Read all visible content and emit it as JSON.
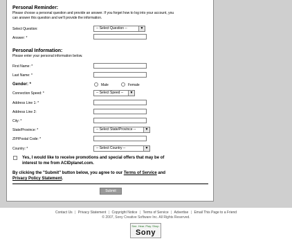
{
  "reminder": {
    "title": "Personal Reminder:",
    "desc_line1": "Please choose a personal question and provide an answer. If you forget how to log into your account, you",
    "desc_line2": "can answer this question and we'll provide the information.",
    "question_label": "Select Question:",
    "question_value": "-- Select Question --",
    "answer_label": "Answer: *",
    "answer_value": ""
  },
  "info": {
    "title": "Personal Information:",
    "desc": "Please enter your personal information below.",
    "first_name_label": "First Name: *",
    "last_name_label": "Last Name: *",
    "gender_label": "Gender: *",
    "male_label": "Male",
    "female_label": "Female",
    "speed_label": "Connection Speed: *",
    "speed_value": "-- Select Speed --",
    "address1_label": "Address Line 1: *",
    "address2_label": "Address Line 2:",
    "city_label": "City: *",
    "state_label": "State/Province: *",
    "state_value": "-- Select State/Province --",
    "zip_label": "ZIP/Postal Code: *",
    "country_label": "Country: *",
    "country_value": "-- Select Country --"
  },
  "promo": {
    "line1": "Yes, I would like to receive promotions and special offers that may be of",
    "line2": "interest to me from ACIDplanet.com."
  },
  "terms": {
    "prefix": "By clicking the \"Submit\" button below, you agree to our ",
    "tos": "Terms of Service",
    "and": " and",
    "privacy": "Privacy Policy Statement",
    "end": "."
  },
  "submit_label": "Submit",
  "footer": {
    "links": [
      "Contact Us",
      "Privacy Statement",
      "Copyright Notice",
      "Terms of Service",
      "Advertise",
      "Email This Page to a Friend"
    ],
    "separator": "|",
    "copyright": "© 2007, Sony Creative Software Inc. All Rights Reserved.",
    "sony_tag": "See. Hear. Play. Shop.",
    "sony_logo": "Sony"
  }
}
